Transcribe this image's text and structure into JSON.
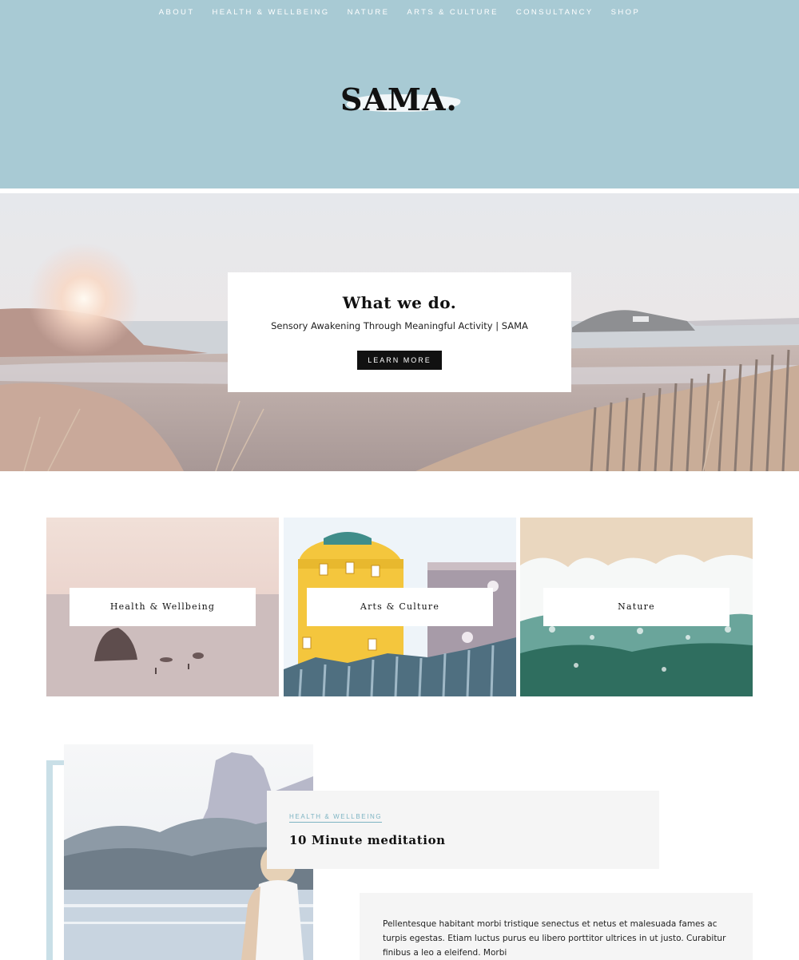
{
  "nav": {
    "items": [
      "ABOUT",
      "HEALTH & WELLBEING",
      "NATURE",
      "ARTS & CULTURE",
      "CONSULTANCY",
      "SHOP"
    ]
  },
  "logo": {
    "text": "SAMA."
  },
  "hero": {
    "title": "What we do.",
    "subtitle": "Sensory Awakening Through Meaningful Activity | SAMA",
    "button_label": "LEARN MORE"
  },
  "tiles": [
    {
      "label": "Health & Wellbeing"
    },
    {
      "label": "Arts & Culture"
    },
    {
      "label": "Nature"
    }
  ],
  "feature": {
    "category": "HEALTH & WELLBEING",
    "title": "10 Minute meditation",
    "excerpt": "Pellentesque habitant morbi tristique senectus et netus et malesuada fames ac turpis egestas. Etiam luctus purus eu libero porttitor ultrices in ut justo. Curabitur finibus a leo a eleifend. Morbi"
  },
  "colors": {
    "header_bg": "#a8cad4",
    "accent": "#7eb4c3",
    "button_bg": "#111111",
    "card_bg": "#f5f5f5"
  }
}
